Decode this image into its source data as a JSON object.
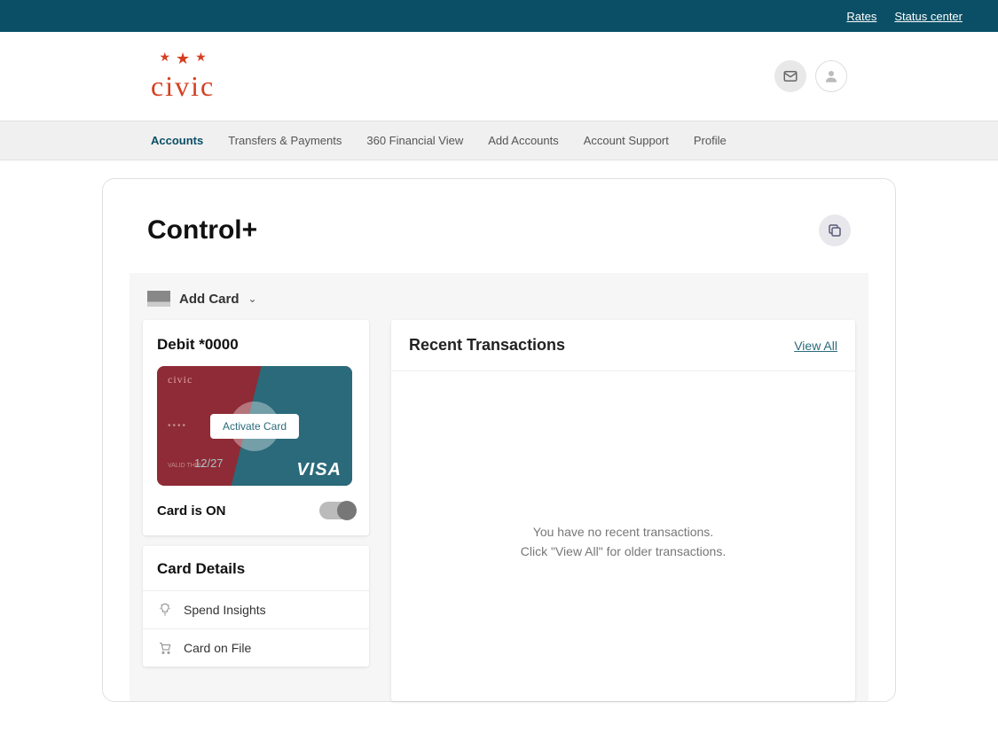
{
  "topbar": {
    "links": [
      "Rates",
      "Status center"
    ]
  },
  "brand": {
    "name": "civic"
  },
  "nav": {
    "items": [
      {
        "label": "Accounts",
        "active": true
      },
      {
        "label": "Transfers & Payments",
        "active": false
      },
      {
        "label": "360 Financial View",
        "active": false
      },
      {
        "label": "Add Accounts",
        "active": false
      },
      {
        "label": "Account Support",
        "active": false
      },
      {
        "label": "Profile",
        "active": false
      }
    ]
  },
  "page": {
    "title": "Control+",
    "add_card_label": "Add Card"
  },
  "card": {
    "name": "Debit *0000",
    "brand_on_card": "civic",
    "masked": "••••",
    "valid_label": "VALID THRU",
    "valid_thru": "12/27",
    "network": "VISA",
    "activate_label": "Activate Card",
    "status_text": "Card is ON",
    "toggle_on": true
  },
  "details": {
    "header": "Card Details",
    "items": [
      {
        "icon": "bulb",
        "label": "Spend Insights"
      },
      {
        "icon": "cart",
        "label": "Card on File"
      }
    ]
  },
  "transactions": {
    "header": "Recent Transactions",
    "view_all": "View All",
    "empty_line1": "You have no recent transactions.",
    "empty_line2": "Click \"View All\" for older transactions."
  }
}
